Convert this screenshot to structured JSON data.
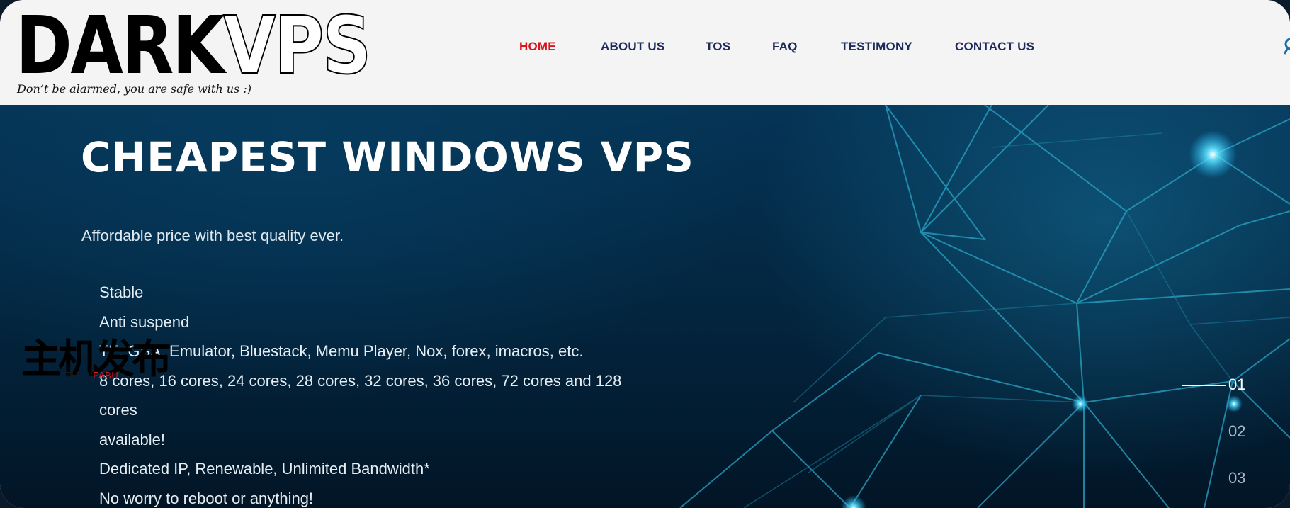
{
  "brand": {
    "logo_dark": "DARK",
    "logo_vps": "VPS",
    "tagline": "Don’t be alarmed, you are safe with us :)"
  },
  "nav": {
    "items": [
      {
        "label": "HOME",
        "active": true
      },
      {
        "label": "ABOUT US",
        "active": false
      },
      {
        "label": "TOS",
        "active": false
      },
      {
        "label": "FAQ",
        "active": false
      },
      {
        "label": "TESTIMONY",
        "active": false
      },
      {
        "label": "CONTACT US",
        "active": false
      }
    ],
    "active_color": "#d8141c",
    "color": "#1e2a5a",
    "search_icon": "search-icon"
  },
  "hero": {
    "title": "CHEAPEST WINDOWS VPS",
    "subtitle": "Affordable price with best quality ever.",
    "features": [
      "Stable",
      "Anti suspend",
      "TE, GSA, Emulator, Bluestack, Memu Player, Nox, forex, imacros, etc.",
      "8 cores, 16 cores, 24 cores, 28 cores, 32 cores, 36 cores, 72 cores and 128 cores",
      "available!",
      "Dedicated IP, Renewable, Unlimited Bandwidth*",
      "No worry to reboot or anything!"
    ],
    "slides": [
      {
        "number": "01",
        "active": true
      },
      {
        "number": "02",
        "active": false
      },
      {
        "number": "03",
        "active": false
      }
    ]
  },
  "watermark": {
    "chinese": "主机发布",
    "latin_a": "ZHUJI",
    "latin_b": "FABU"
  }
}
